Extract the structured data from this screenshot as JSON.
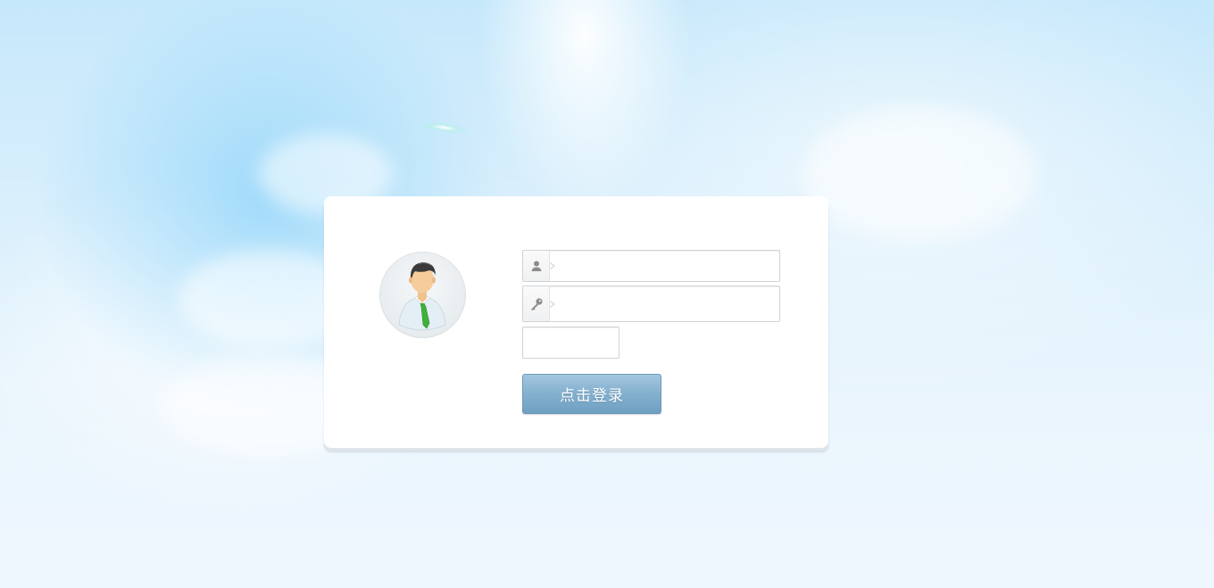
{
  "login": {
    "username": {
      "value": "",
      "placeholder": "",
      "icon": "user-icon"
    },
    "password": {
      "value": "",
      "placeholder": "",
      "icon": "key-icon"
    },
    "captcha": {
      "value": "",
      "placeholder": ""
    },
    "submit_label": "点击登录"
  },
  "avatar": {
    "icon": "user-avatar-icon"
  },
  "colors": {
    "button_top": "#a3c7df",
    "button_bottom": "#6f9fc2",
    "sky": "#c6e8fb",
    "panel": "#ffffff"
  }
}
